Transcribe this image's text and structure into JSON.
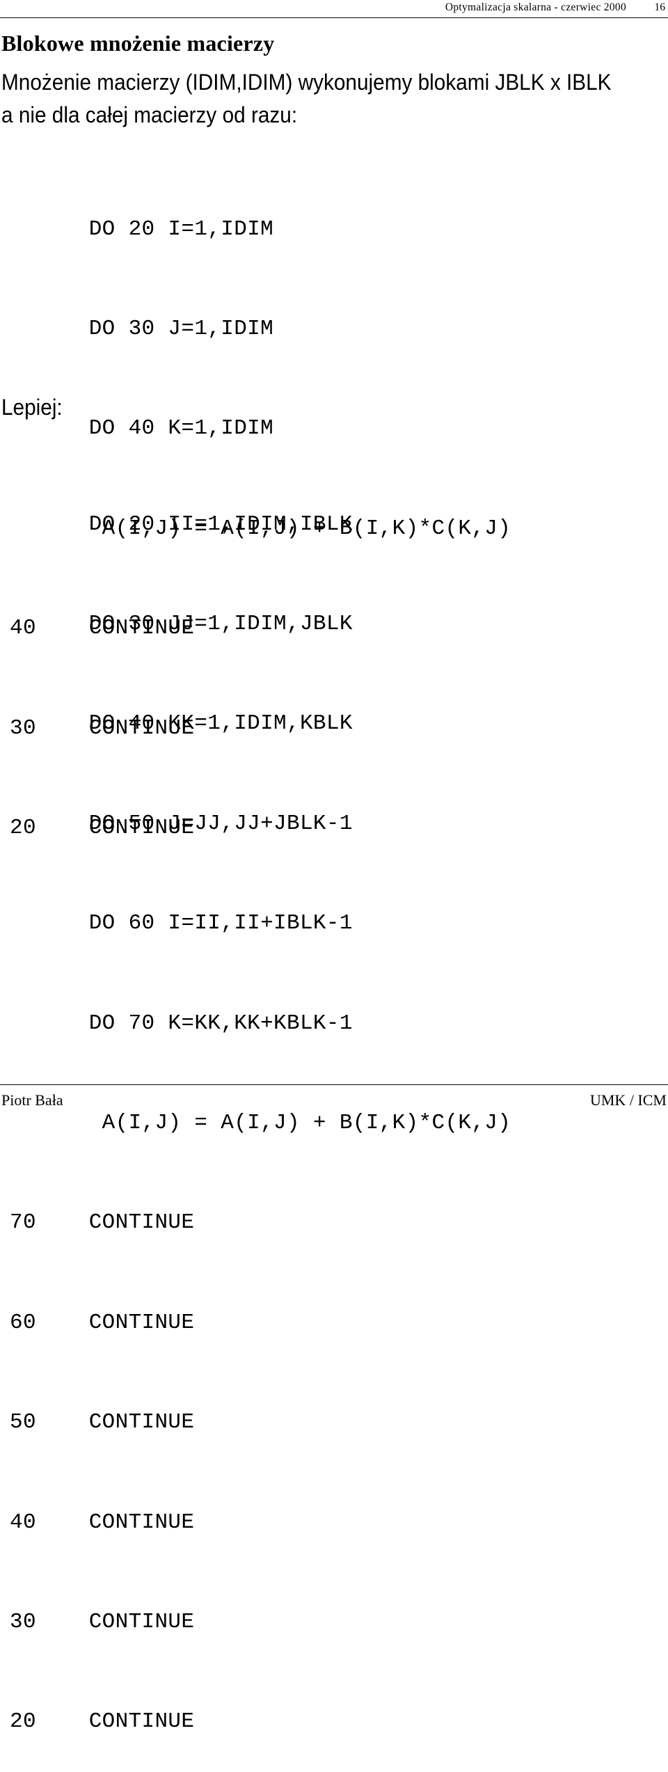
{
  "header": {
    "title": "Optymalizacja skalarna - czerwiec 2000",
    "page_number": "16"
  },
  "slide": {
    "title": "Blokowe mnożenie macierzy",
    "body_lines": [
      "Mnożenie macierzy (IDIM,IDIM) wykonujemy blokami JBLK x IBLK",
      "a nie dla całej macierzy od razu:"
    ],
    "section_label": "Lepiej:",
    "code_block_1": [
      "      DO 20 I=1,IDIM",
      "      DO 30 J=1,IDIM",
      "      DO 40 K=1,IDIM",
      "       A(I,J) = A(I,J) + B(I,K)*C(K,J)",
      "40    CONTINUE",
      "30    CONTINUE",
      "20    CONTINUE"
    ],
    "code_block_2": [
      "      DO 20 II=1,IDIM,IBLK",
      "      DO 30 JJ=1,IDIM,JBLK",
      "      DO 40 KK=1,IDIM,KBLK",
      "      DO 50 J=JJ,JJ+JBLK-1",
      "      DO 60 I=II,II+IBLK-1",
      "      DO 70 K=KK,KK+KBLK-1",
      "       A(I,J) = A(I,J) + B(I,K)*C(K,J)",
      "70    CONTINUE",
      "60    CONTINUE",
      "50    CONTINUE",
      "40    CONTINUE",
      "30    CONTINUE",
      "20    CONTINUE"
    ]
  },
  "footer": {
    "author": "Piotr Bała",
    "affiliation": "UMK / ICM"
  },
  "colors": {
    "text": "#000000",
    "background": "#ffffff",
    "rule": "#000000"
  }
}
